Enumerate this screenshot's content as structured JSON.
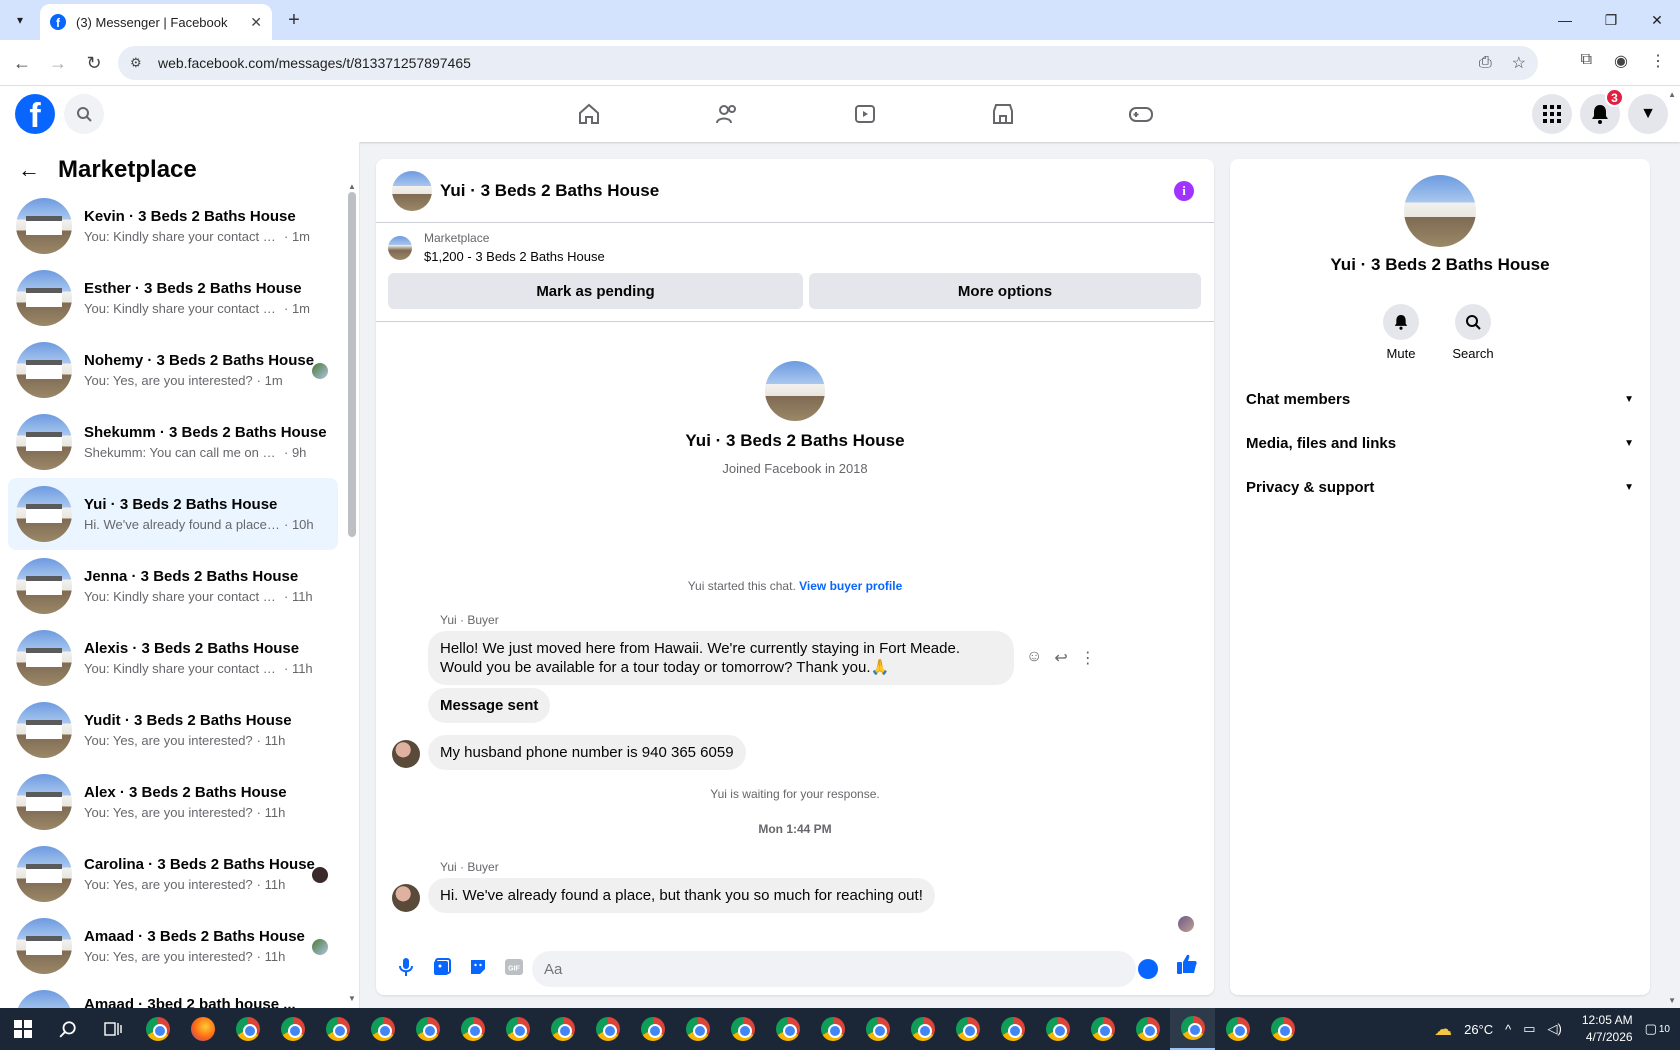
{
  "browser": {
    "tab_title": "(3) Messenger | Facebook",
    "url": "web.facebook.com/messages/t/813371257897465"
  },
  "header": {
    "notification_count": "3"
  },
  "sidebar": {
    "title": "Marketplace",
    "conversations": [
      {
        "name": "Kevin · 3 Beds 2 Baths House",
        "preview": "You: Kindly share your contact nu...",
        "time": "· 1m"
      },
      {
        "name": "Esther · 3 Beds 2 Baths House",
        "preview": "You: Kindly share your contact nu...",
        "time": "· 1m"
      },
      {
        "name": "Nohemy · 3 Beds 2 Baths House",
        "preview": "You: Yes, are you interested?",
        "time": "· 1m"
      },
      {
        "name": "Shekumm · 3 Beds 2 Baths House",
        "preview": "Shekumm: You can call me on 770 ...",
        "time": "· 9h"
      },
      {
        "name": "Yui · 3 Beds 2 Baths House",
        "preview": "Hi. We've already found a place, b...",
        "time": "· 10h"
      },
      {
        "name": "Jenna · 3 Beds 2 Baths House",
        "preview": "You: Kindly share your contact nu...",
        "time": "· 11h"
      },
      {
        "name": "Alexis · 3 Beds 2 Baths House",
        "preview": "You: Kindly share your contact nu...",
        "time": "· 11h"
      },
      {
        "name": "Yudit · 3 Beds 2 Baths House",
        "preview": "You: Yes, are you interested?",
        "time": "· 11h"
      },
      {
        "name": "Alex · 3 Beds 2 Baths House",
        "preview": "You: Yes, are you interested?",
        "time": "· 11h"
      },
      {
        "name": "Carolina · 3 Beds 2 Baths House",
        "preview": "You: Yes, are you interested?",
        "time": "· 11h"
      },
      {
        "name": "Amaad · 3 Beds 2 Baths House",
        "preview": "You: Yes, are you interested?",
        "time": "· 11h"
      },
      {
        "name": "Amaad · 3bed 2 bath house ...",
        "preview": "",
        "time": ""
      }
    ]
  },
  "chat": {
    "title": "Yui · 3 Beds 2 Baths House",
    "listing_category": "Marketplace",
    "listing_price": "$1,200 - 3 Beds 2 Baths House",
    "mark_pending_label": "Mark as pending",
    "more_options_label": "More options",
    "profile_name": "Yui · 3 Beds 2 Baths House",
    "profile_joined": "Joined Facebook in 2018",
    "started_text": "Yui started this chat.",
    "view_profile_link": "View buyer profile",
    "sender_label": "Yui · Buyer",
    "msg1_line1": "Hello! We just moved here from Hawaii. We're currently staying in Fort Meade.",
    "msg1_line2": "Would you be available for a tour today or tomorrow? Thank you.🙏",
    "msg2": "Message sent",
    "msg3": "My husband phone number is 940 365 6059",
    "waiting_text": "Yui is waiting for your response.",
    "timestamp": "Mon 1:44 PM",
    "sender_label2": "Yui · Buyer",
    "msg4": "Hi. We've already found a place, but thank you so much for reaching out!",
    "composer_placeholder": "Aa"
  },
  "right_panel": {
    "name": "Yui · 3 Beds 2 Baths House",
    "mute_label": "Mute",
    "search_label": "Search",
    "sections": [
      "Chat members",
      "Media, files and links",
      "Privacy & support"
    ]
  },
  "taskbar": {
    "temperature": "26°C",
    "time": "12:05 AM",
    "date": "4/7/2026",
    "notif_count": "10"
  },
  "colors": {
    "accent": "#0866ff",
    "active_conv_bg": "#ebf5ff",
    "info_purple": "#a033ff",
    "badge_red": "#e41e3f"
  }
}
